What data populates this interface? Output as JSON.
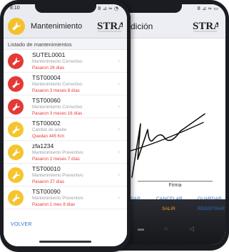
{
  "back_screen": {
    "status_icons": "8 ⊿ ≈ ▭",
    "title": "dición",
    "logo_text": "STRA",
    "signature_label": "Firma",
    "buttons": {
      "clear": "PIAR",
      "cancel": "CANCELAR",
      "save": "GUARDAR"
    },
    "bottom": {
      "exit": "SALIR",
      "register": "REGISTRAR"
    }
  },
  "front_screen": {
    "time": "8:10",
    "status_icons": "8 ⊿ ≈ ◔",
    "title": "Mantenimiento",
    "logo_text": "STRA",
    "section_title": "Listado de mantenimientos",
    "items": [
      {
        "code": "SUTEL0001",
        "type": "Mantenimiento Correctivo",
        "status": "Pasaron 26 días",
        "badge": "red",
        "icon": "wrench-icon"
      },
      {
        "code": "TST00004",
        "type": "Mantenimiento Correctivo",
        "status": "Pasaron 3 meses 8 días",
        "badge": "red",
        "icon": "wrench-icon"
      },
      {
        "code": "TST00060",
        "type": "Mantenimiento Correctivo",
        "status": "Pasaron 3 meses 16 días",
        "badge": "red",
        "icon": "wrench-icon"
      },
      {
        "code": "TST00002",
        "type": "Cambio de aceite",
        "status": "Quedan 445 Km",
        "badge": "yellow",
        "icon": "wrench-icon"
      },
      {
        "code": "zfa1234",
        "type": "Mantenimiento Preventivo",
        "status": "Pasaron 2 meses 7 días",
        "badge": "yellow",
        "icon": "wrench-icon"
      },
      {
        "code": "TST00010",
        "type": "Mantenimiento Preventivo",
        "status": "Pasaron 27 días",
        "badge": "yellow",
        "icon": "wrench-icon"
      },
      {
        "code": "TST00090",
        "type": "Mantenimiento Preventivo",
        "status": "Pasaron 1 mes 8 días",
        "badge": "yellow",
        "icon": "wrench-icon"
      }
    ],
    "back_label": "VOLVER"
  },
  "colors": {
    "accent_blue": "#2b6fc6",
    "badge_red": "#e53935",
    "badge_yellow": "#f5c530",
    "status_red": "#e53935"
  }
}
